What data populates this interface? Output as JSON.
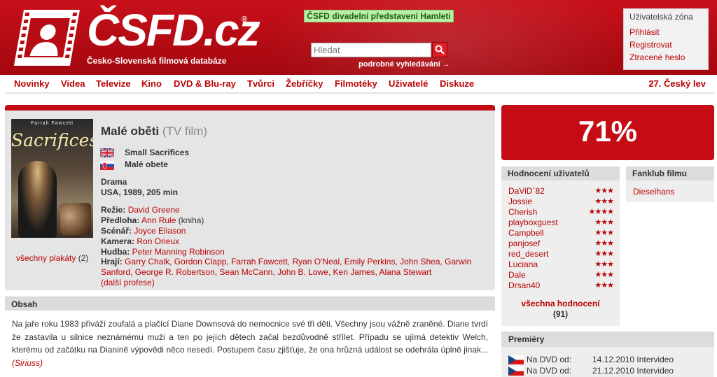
{
  "header": {
    "logo_text": "ČSFD.cz",
    "logo_registered": "®",
    "tagline": "Česko-Slovenská filmová databáze",
    "promo": "ČSFD divadelní představení Hamleti",
    "search_placeholder": "Hledat",
    "advanced_search": "podrobné vyhledávání →",
    "user_zone": {
      "title": "Uživatelská zóna",
      "links": [
        "Přihlásit",
        "Registrovat",
        "Ztracené heslo"
      ]
    }
  },
  "nav": {
    "items": [
      "Novinky",
      "Videa",
      "Televize",
      "Kino",
      "DVD & Blu-ray",
      "Tvůrci",
      "Žebříčky",
      "Filmotéky",
      "Uživatelé",
      "Diskuze"
    ],
    "right": "27. Český lev"
  },
  "film": {
    "title": "Malé oběti",
    "type": "(TV film)",
    "poster_top": "Farrah Fawcett",
    "poster_title": "Sacrifices",
    "poster_small": "small",
    "posters_link": "všechny plakáty",
    "posters_count": "(2)",
    "alt_titles": [
      {
        "flag": "gb",
        "title": "Small Sacrifices"
      },
      {
        "flag": "sk",
        "title": "Malé obete"
      }
    ],
    "genre": "Drama",
    "origin": "USA, 1989, 205 min",
    "credits": {
      "director_label": "Režie:",
      "director": "David Greene",
      "source_label": "Předloha:",
      "source": "Ann Rule",
      "source_note": "(kniha)",
      "screenplay_label": "Scénář:",
      "screenplay": "Joyce Eliason",
      "camera_label": "Kamera:",
      "camera": "Ron Orieux",
      "music_label": "Hudba:",
      "music": "Peter Manning Robinson",
      "cast_label": "Hrají:",
      "cast": "Garry Chalk, Gordon Clapp, Farrah Fawcett, Ryan O'Neal, Emily Perkins, John Shea, Garwin Sanford, George R. Robertson, Sean McCann, John B. Lowe, Ken James, Alana Stewart",
      "more": "(další profese)"
    }
  },
  "plot": {
    "header": "Obsah",
    "text": "Na jaře roku 1983 přiváží zoufalá a plačící Diane Downsová do nemocnice své tři děti. Všechny jsou vážně zraněné. Diane tvrdí že zastavila u silnice neznámému muži a ten po jejích dětech začal bezdůvodně střílet. Případu se ujímá detektiv Welch, kterému od začátku na Dianině výpovědi něco nesedí. Postupem času zjišťuje, že ona hrůzná událost se odehrála úplně jinak... ",
    "author": "(Siriuss)"
  },
  "rating": {
    "percent": "71%"
  },
  "user_ratings": {
    "header": "Hodnocení uživatelů",
    "items": [
      {
        "name": "DaViD´82",
        "stars": "★★★",
        "rating": 3
      },
      {
        "name": "Jossie",
        "stars": "★★★",
        "rating": 3
      },
      {
        "name": "Cherish",
        "stars": "★★★★",
        "rating": 4
      },
      {
        "name": "playboxguest",
        "stars": "★★★",
        "rating": 3
      },
      {
        "name": "Campbell",
        "stars": "★★★",
        "rating": 3
      },
      {
        "name": "panjosef",
        "stars": "★★★",
        "rating": 3
      },
      {
        "name": "red_desert",
        "stars": "★★★",
        "rating": 3
      },
      {
        "name": "Luciana",
        "stars": "★★★",
        "rating": 3
      },
      {
        "name": "Dale",
        "stars": "★★★",
        "rating": 3
      },
      {
        "name": "Drsan40",
        "stars": "★★★",
        "rating": 3
      }
    ],
    "all_link": "všechna hodnocení",
    "all_count": "(91)"
  },
  "fanclub": {
    "header": "Fanklub filmu",
    "members": [
      "Dieselhans"
    ]
  },
  "premieres": {
    "header": "Premiéry",
    "items": [
      {
        "flag": "cz",
        "label": "Na DVD od:",
        "date": "14.12.2010 Intervideo"
      },
      {
        "flag": "cz",
        "label": "Na DVD od:",
        "date": "21.12.2010 Intervideo"
      }
    ]
  },
  "colors": {
    "brand_red": "#c50c14",
    "link_red": "#ba0305",
    "promo_green": "#b9f0a6"
  },
  "icons": {
    "logo": "film-strip-person-icon",
    "search": "search-icon"
  }
}
